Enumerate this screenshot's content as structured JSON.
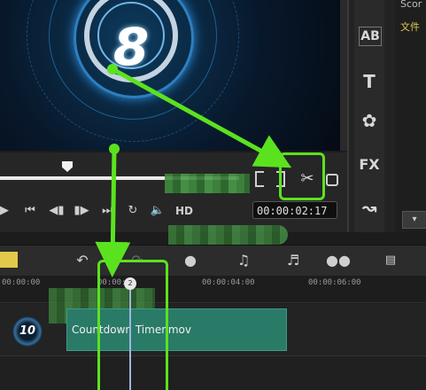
{
  "preview": {
    "countdown_number": "8"
  },
  "side_panel": {
    "tool_icons": [
      "AB",
      "T",
      "✿",
      "FX",
      "↝"
    ],
    "list_items": [
      "Scor",
      "文件"
    ]
  },
  "player": {
    "hd_label": "HD",
    "timecode": "00:00:02:17"
  },
  "ruler": {
    "ticks": [
      "00:00:00",
      "00:00:02",
      "00:00:04:00",
      "00:00:06:00"
    ]
  },
  "timeline": {
    "clip_label": "Countdown Timer.mov",
    "thumb_number": "10"
  },
  "colors": {
    "annotation": "#5be21f",
    "clip": "#2a7a68"
  }
}
